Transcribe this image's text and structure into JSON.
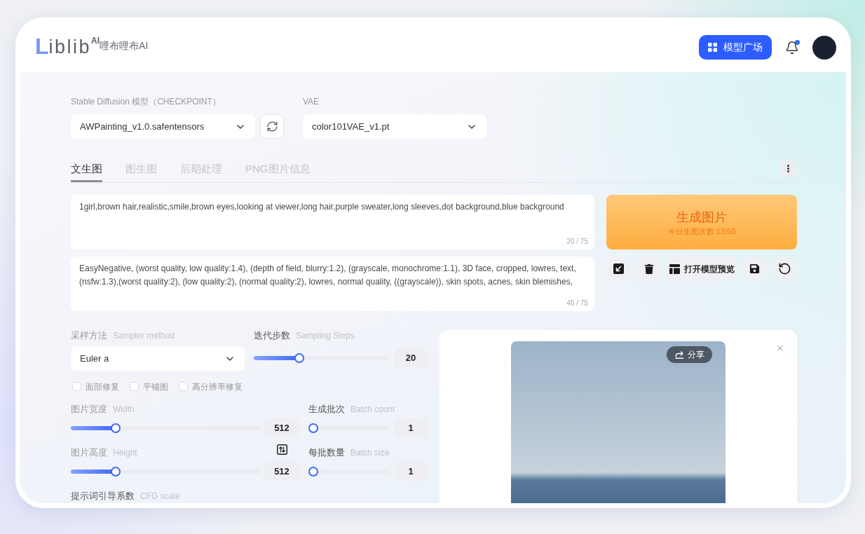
{
  "header": {
    "logo": {
      "initial": "L",
      "wordmark": "iblib",
      "badge": "AI",
      "name": "哩布哩布AI"
    },
    "nav_button": "模型广场",
    "notifications": {
      "unread": true
    }
  },
  "checkpoint": {
    "label": "Stable Diffusion 模型（CHECKPOINT）",
    "value": "AWPainting_v1.0.safentensors"
  },
  "vae": {
    "label": "VAE",
    "value": "color101VAE_v1.pt"
  },
  "tabs": [
    {
      "label": "文生图",
      "selected": true
    },
    {
      "label": "图生图",
      "selected": false
    },
    {
      "label": "后期处理",
      "selected": false
    },
    {
      "label": "PNG图片信息",
      "selected": false
    }
  ],
  "prompt": {
    "value": "1girl,brown hair,realistic,smile,brown eyes,looking at viewer,long hair,purple sweater,long sleeves,dot background,blue background",
    "counter": "20 / 75"
  },
  "negative_prompt": {
    "value": "EasyNegative, (worst quality, low quality:1.4), (depth of field, blurry:1.2), (grayscale, monochrome:1.1), 3D face, cropped, lowres, text, (nsfw:1.3),(worst quality:2), (low quality:2), (normal quality:2), lowres, normal quality, ((grayscale)), skin spots, acnes, skin blemishes,",
    "counter": "45 / 75"
  },
  "generate": {
    "label": "生成图片",
    "quota": "今日生图次数 12/50"
  },
  "preview_button": "打开模型预览",
  "sampler": {
    "label": "采样方法",
    "hint": "Sampler method",
    "value": "Euler a"
  },
  "steps": {
    "label": "迭代步数",
    "hint": "Sampling Steps",
    "level": 0.32,
    "value": "20"
  },
  "options": [
    {
      "label": "面部修复",
      "checked": false
    },
    {
      "label": "平铺图",
      "checked": false
    },
    {
      "label": "高分辨率修复",
      "checked": false
    }
  ],
  "width": {
    "label": "图片宽度",
    "hint": "Width",
    "level": 0.22,
    "value": "512"
  },
  "batch_count": {
    "label": "生成批次",
    "hint": "Batch count",
    "level": 0,
    "value": "1"
  },
  "height": {
    "label": "图片高度",
    "hint": "Height",
    "level": 0.22,
    "value": "512"
  },
  "batch_size": {
    "label": "每批数量",
    "hint": "Batch size",
    "level": 0,
    "value": "1"
  },
  "cfg": {
    "label": "提示词引导系数",
    "hint": "CFG scale"
  },
  "result": {
    "share_button": "分享"
  }
}
